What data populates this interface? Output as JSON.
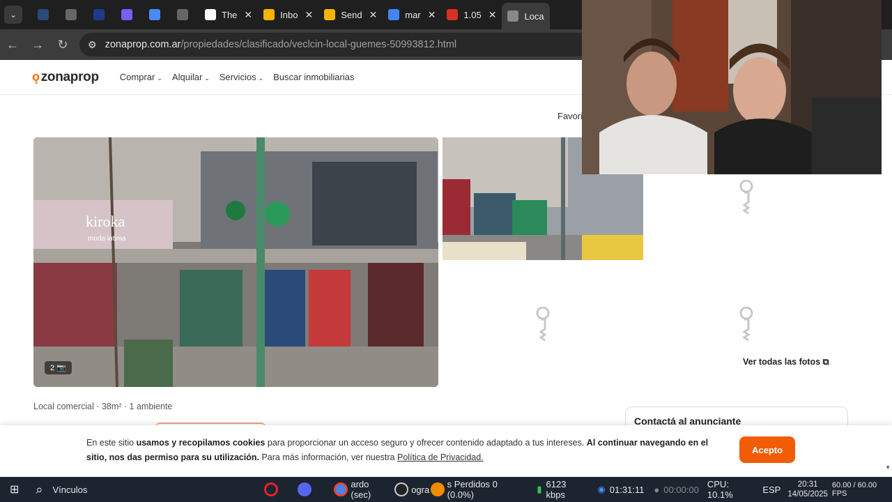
{
  "browser": {
    "tabs": [
      {
        "label": "",
        "color": "#2a4a7a",
        "active": false
      },
      {
        "label": "",
        "color": "#666666",
        "active": false
      },
      {
        "label": "",
        "color": "#1e3a8a",
        "active": false
      },
      {
        "label": "",
        "color": "#7c5cff",
        "active": false
      },
      {
        "label": "",
        "color": "#4a8af4",
        "active": false
      },
      {
        "label": "",
        "color": "#666666",
        "active": false
      },
      {
        "label": "The",
        "color": "#ffffff",
        "active": false
      },
      {
        "label": "Inbo",
        "color": "#f4b400",
        "active": false
      },
      {
        "label": "Send",
        "color": "#f4b400",
        "active": false
      },
      {
        "label": "mar",
        "color": "#4285f4",
        "active": false
      },
      {
        "label": "1.05",
        "color": "#d93025",
        "active": false
      },
      {
        "label": "Loca",
        "color": "#888888",
        "active": true
      }
    ],
    "url_host": "zonaprop.com.ar",
    "url_path": "/propiedades/clasificado/veclcin-local-guemes-50993812.html"
  },
  "site": {
    "logo": "zonaprop",
    "nav": [
      {
        "label": "Comprar",
        "has_menu": true
      },
      {
        "label": "Alquilar",
        "has_menu": true
      },
      {
        "label": "Servicios",
        "has_menu": true
      },
      {
        "label": "Buscar inmobiliarias",
        "has_menu": false
      }
    ],
    "favoritos": "Favori"
  },
  "listing": {
    "photo_count": "2",
    "ver_todas": "Ver todas las fotos",
    "meta": "Local comercial · 38m² · 1 ambiente",
    "contact_title": "Contactá al anunciante",
    "storefront_sign": "kiroka",
    "storefront_sub": "moda intima"
  },
  "cookie": {
    "p1": "En este sitio ",
    "b1": "usamos y recopilamos cookies",
    "p2": " para proporcionar un acceso seguro y ofrecer contenido adaptado a tus intereses. ",
    "b2": "Al continuar navegando en el sitio, nos das permiso para su utilización.",
    "p3": " Para más información, ver nuestra ",
    "link": "Política de Privacidad.",
    "accept": "Acepto"
  },
  "taskbar": {
    "search": "Vínculos",
    "media": "ardo (sec)",
    "media2": "ogra",
    "media3": "s Perdidos 0 (0.0%)",
    "bitrate": "6123 kbps",
    "time_rec": "01:31:11",
    "time_stream": "00:00:00",
    "cpu": "CPU: 10.1%",
    "fps": "60.00 / 60.00 FPS",
    "lang": "ESP",
    "clock_time": "20:31",
    "clock_date": "14/05/2025"
  }
}
